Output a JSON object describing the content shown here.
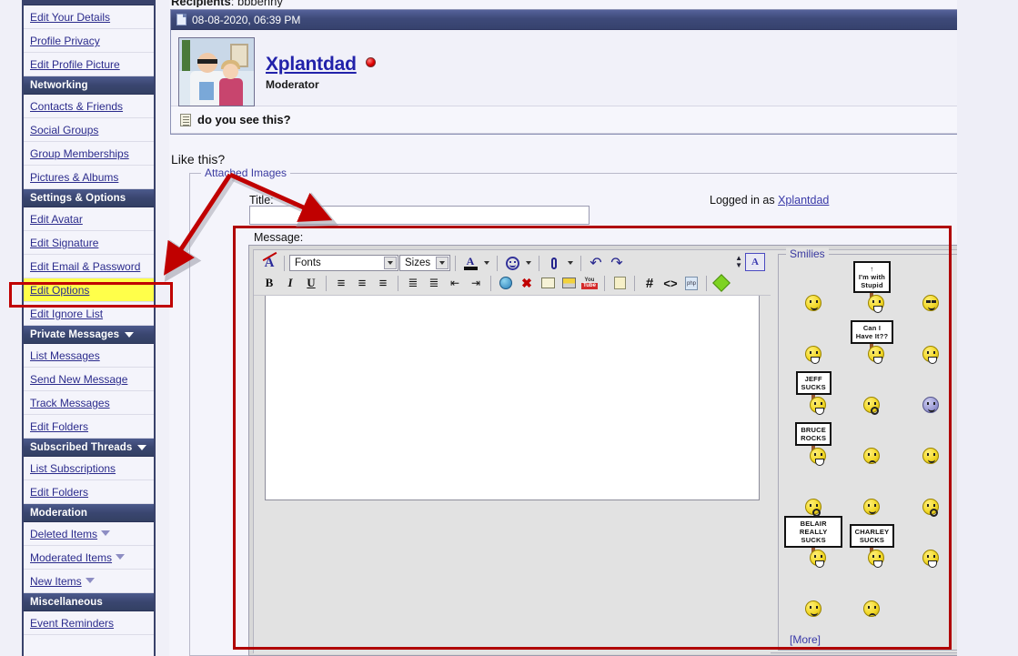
{
  "header": {
    "recipients_label": "Recipients",
    "recipients_value": ": bbbenny",
    "date": "08-08-2020, 06:39 PM"
  },
  "post": {
    "author": "Xplantdad",
    "author_title": "Moderator",
    "body_text": "do you see this?",
    "like_this": "Like this?"
  },
  "sidebar": {
    "groups": [
      {
        "header": null,
        "items": [
          {
            "label": "Edit Your Details",
            "caret": false
          },
          {
            "label": "Profile Privacy",
            "caret": false
          },
          {
            "label": "Edit Profile Picture",
            "caret": false
          }
        ]
      },
      {
        "header": "Networking",
        "header_caret": false,
        "items": [
          {
            "label": "Contacts & Friends",
            "caret": false
          },
          {
            "label": "Social Groups",
            "caret": false
          },
          {
            "label": "Group Memberships",
            "caret": false
          },
          {
            "label": "Pictures & Albums",
            "caret": false
          }
        ]
      },
      {
        "header": "Settings & Options",
        "header_caret": false,
        "items": [
          {
            "label": "Edit Avatar",
            "caret": false
          },
          {
            "label": "Edit Signature",
            "caret": false
          },
          {
            "label": "Edit Email & Password",
            "caret": false
          },
          {
            "label": "Edit Options",
            "caret": false,
            "highlighted": true
          },
          {
            "label": "Edit Ignore List",
            "caret": false
          }
        ]
      },
      {
        "header": "Private Messages",
        "header_caret": true,
        "items": [
          {
            "label": "List Messages",
            "caret": false
          },
          {
            "label": "Send New Message",
            "caret": false
          },
          {
            "label": "Track Messages",
            "caret": false
          },
          {
            "label": "Edit Folders",
            "caret": false
          }
        ]
      },
      {
        "header": "Subscribed Threads",
        "header_caret": true,
        "items": [
          {
            "label": "List Subscriptions",
            "caret": false
          },
          {
            "label": "Edit Folders",
            "caret": false
          }
        ]
      },
      {
        "header": "Moderation",
        "header_caret": false,
        "items": [
          {
            "label": "Deleted Items",
            "caret": true
          },
          {
            "label": "Moderated Items",
            "caret": true
          },
          {
            "label": "New Items",
            "caret": true
          }
        ]
      },
      {
        "header": "Miscellaneous",
        "header_caret": false,
        "items": [
          {
            "label": "Event Reminders",
            "caret": false
          }
        ]
      }
    ]
  },
  "form": {
    "attached_images_legend": "Attached Images",
    "title_label": "Title:",
    "title_value": "",
    "title_placeholder": "",
    "message_label": "Message:",
    "message_value": "",
    "logged_in_prefix": "Logged in as ",
    "logged_in_user": "Xplantdad"
  },
  "editor": {
    "fonts_select": "Fonts",
    "sizes_select": "Sizes",
    "row1": [
      {
        "name": "remove-formatting-icon",
        "glyph": "A"
      },
      {
        "name": "font-color-icon",
        "glyph": "A"
      },
      {
        "name": "smilie-icon",
        "glyph": "☺"
      },
      {
        "name": "attachment-icon",
        "glyph": "📎"
      },
      {
        "name": "undo-icon",
        "glyph": "↶"
      },
      {
        "name": "redo-icon",
        "glyph": "↷"
      }
    ],
    "row2": [
      {
        "name": "bold-button",
        "glyph": "B"
      },
      {
        "name": "italic-button",
        "glyph": "I"
      },
      {
        "name": "underline-button",
        "glyph": "U"
      },
      {
        "name": "align-left-button",
        "glyph": "≡"
      },
      {
        "name": "align-center-button",
        "glyph": "≡"
      },
      {
        "name": "align-right-button",
        "glyph": "≡"
      },
      {
        "name": "ordered-list-button",
        "glyph": "≣"
      },
      {
        "name": "unordered-list-button",
        "glyph": "≣"
      },
      {
        "name": "outdent-button",
        "glyph": "«"
      },
      {
        "name": "indent-button",
        "glyph": "»"
      },
      {
        "name": "insert-link-button",
        "glyph": "🌐"
      },
      {
        "name": "remove-link-button",
        "glyph": "✖"
      },
      {
        "name": "insert-email-button",
        "glyph": "✉"
      },
      {
        "name": "insert-image-button",
        "glyph": "🖼"
      },
      {
        "name": "youtube-button",
        "glyph": "You"
      },
      {
        "name": "quote-button",
        "glyph": "“"
      },
      {
        "name": "hash-button",
        "glyph": "#"
      },
      {
        "name": "code-button",
        "glyph": "<>"
      },
      {
        "name": "php-button",
        "glyph": "php"
      },
      {
        "name": "highlight-button",
        "glyph": "◆"
      }
    ],
    "toggle_mode_label": "A",
    "smilies_legend": "Smilies",
    "more_link": "[More]"
  },
  "smilies": [
    {
      "type": "face",
      "name": "smilie-confused",
      "variant": ""
    },
    {
      "type": "sign",
      "name": "smilie-im-with-stupid",
      "text": "↑\nI'm with\nStupid"
    },
    {
      "type": "face",
      "name": "smilie-cool",
      "variant": "shades"
    },
    {
      "type": "face",
      "name": "smilie-bow",
      "variant": "grin"
    },
    {
      "type": "sign",
      "name": "smilie-can-i-have-it",
      "text": "Can I\nHave It??"
    },
    {
      "type": "face",
      "name": "smilie-big-grin",
      "variant": "grin"
    },
    {
      "type": "sign",
      "name": "smilie-jeff-sucks",
      "text": "JEFF\nSUCKS"
    },
    {
      "type": "face",
      "name": "smilie-surprised",
      "variant": "o"
    },
    {
      "type": "face",
      "name": "smilie-dead",
      "variant": "purple"
    },
    {
      "type": "sign",
      "name": "smilie-bruce-rocks",
      "text": "BRUCE\nROCKS"
    },
    {
      "type": "face",
      "name": "smilie-crying",
      "variant": "sad"
    },
    {
      "type": "face",
      "name": "smilie-wave",
      "variant": ""
    },
    {
      "type": "face",
      "name": "smilie-worried",
      "variant": "o"
    },
    {
      "type": "face",
      "name": "smilie-thumbs-down",
      "variant": ""
    },
    {
      "type": "face",
      "name": "smilie-eek",
      "variant": "o"
    },
    {
      "type": "sign",
      "name": "smilie-belair-really-sucks",
      "text": "BELAIR\nREALLY SUCKS"
    },
    {
      "type": "sign",
      "name": "smilie-charley-sucks",
      "text": "CHARLEY\nSUCKS"
    },
    {
      "type": "face",
      "name": "smilie-teeth",
      "variant": "grin"
    },
    {
      "type": "face",
      "name": "smilie-smile",
      "variant": ""
    },
    {
      "type": "face",
      "name": "smilie-question",
      "variant": "sad"
    },
    {
      "type": "empty",
      "name": "smilie-empty",
      "variant": ""
    }
  ],
  "colors": {
    "nav_header_bg": "#3a4670",
    "link": "#2b2b8c",
    "highlight": "#ffff4a",
    "annotation_red": "#b00000",
    "date_bar": "#3e4a79"
  }
}
